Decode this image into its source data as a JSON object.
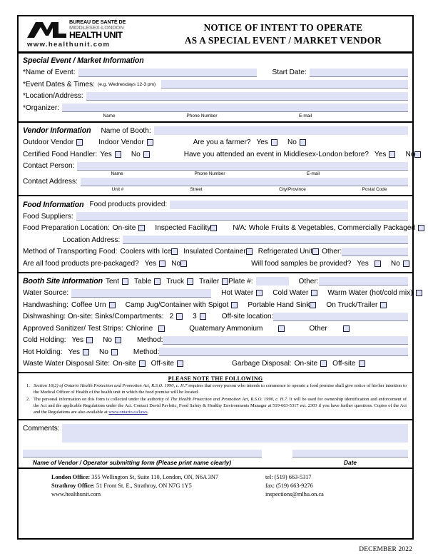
{
  "header": {
    "logo": {
      "line1": "BUREAU DE SANTÉ DE",
      "line2": "MIDDLESEX-LONDON",
      "line3": "HEALTH UNIT",
      "url": "www.healthunit.com"
    },
    "title_line1": "NOTICE OF INTENT TO OPERATE",
    "title_line2": "AS A SPECIAL EVENT / MARKET VENDOR"
  },
  "special_event": {
    "section_title": "Special Event / Market Information",
    "name_of_event_label": "*Name of Event:",
    "start_date_label": "Start Date:",
    "event_dates_label": "*Event Dates & Times",
    "event_dates_hint": "(e.g. Wednesdays 12-3 pm)",
    "location_label": "*Location/Address:",
    "organizer_label": "*Organizer:",
    "caption_name": "Name",
    "caption_phone": "Phone Number",
    "caption_email": "E-mail"
  },
  "vendor": {
    "section_title": "Vendor Information",
    "booth_label": "Name of Booth:",
    "outdoor_label": "Outdoor Vendor",
    "indoor_label": "Indoor Vendor",
    "farmer_label": "Are you a farmer?",
    "yes": "Yes",
    "no": "No",
    "certified_label": "Certified Food Handler:",
    "attended_label": "Have you attended an event in Middlesex-London before?",
    "contact_person_label": "Contact Person:",
    "contact_address_label": "Contact Address:",
    "caption_name": "Name",
    "caption_phone": "Phone Number",
    "caption_email": "E-mail",
    "caption_unit": "Unit #",
    "caption_street": "Street",
    "caption_city": "City/Province",
    "caption_postal": "Postal Code"
  },
  "food": {
    "section_title": "Food Information",
    "products_label": "Food products provided:",
    "suppliers_label": "Food Suppliers:",
    "prep_location_label": "Food Preparation Location:",
    "prep_onsite": "On-site",
    "prep_inspected": "Inspected Facility",
    "prep_na": "N/A: Whole Fruits & Vegetables, Commercially Packaged",
    "location_address_label": "Location Address:",
    "transport_label": "Method of Transporting Food:",
    "transport_coolers": "Coolers with Ice",
    "transport_insulated": "Insulated Container",
    "transport_refrigerated": "Refrigerated Unit",
    "transport_other": "Other:",
    "prepackaged_label": "Are all food products pre-packaged?",
    "samples_label": "Will food samples be provided?",
    "yes": "Yes",
    "no": "No"
  },
  "booth": {
    "section_title": "Booth Site Information",
    "tent": "Tent",
    "table": "Table",
    "truck": "Truck",
    "trailer": "Trailer",
    "plate_label": "Plate #:",
    "other_label": "Other:",
    "water_source_label": "Water Source:",
    "hot_water": "Hot Water",
    "cold_water": "Cold Water",
    "warm_water": "Warm Water (hot/cold mix)",
    "handwashing_label": "Handwashing:",
    "coffee_urn": "Coffee Urn",
    "camp_jug": "Camp Jug/Container with Spigot",
    "portable_sink": "Portable Hand Sink",
    "on_truck": "On Truck/Trailer",
    "dishwashing_label": "Dishwashing: On-site: Sinks/Compartments:",
    "sinks_2": "2",
    "sinks_3": "3",
    "offsite_location_label": "Off-site location:",
    "sanitizer_label": "Approved Sanitizer/ Test Strips:",
    "chlorine": "Chlorine",
    "quaternary": "Quatemary Ammonium",
    "other": "Other",
    "cold_holding_label": "Cold Holding:",
    "hot_holding_label": "Hot Holding:",
    "method_label": "Method:",
    "waste_label": "Waste Water Disposal Site:",
    "garbage_label": "Garbage Disposal:",
    "onsite": "On-site",
    "offsite": "Off-site",
    "yes": "Yes",
    "no": "No"
  },
  "notes": {
    "title": "PLEASE NOTE THE FOLLOWING",
    "items": [
      {
        "number": "1.",
        "italic_lead": "Section 16(2) of Ontario Health Protection and Promotion Act, R.S.O. 1990, c. H.7",
        "text": " requires that every person who intends to commence to operate a food premise shall give notice of his/her intention to the Medical Officer of Health of the health unit in which the food premise will be located."
      },
      {
        "number": "2.",
        "text_a": "The personal information on this form is collected under the authority of ",
        "italic_mid": "The Health Protection and Promotion Act, R.S.O. 1990, c. H.7",
        "text_b": ".  It will be used for ownership identification and enforcement of the Act and the applicable Regulations under the Act.  Contact David Pavletic, Food Safety & Healthy Environments Manager at 519-663-5317 ext. 2303 if you have further questions. Copies of the Act and the Regulations are also available at ",
        "link": "www.ontario.ca/laws",
        "text_c": "."
      }
    ]
  },
  "comments": {
    "label": "Comments:",
    "name_caption": "Name of Vendor / Operator submitting form (Please print name clearly)",
    "date_caption": "Date"
  },
  "footer": {
    "london_label": "London Office:",
    "london_address": " 355 Wellington St, Suite 110, London, ON, N6A 3N7",
    "strathroy_label": "Strathroy Office:",
    "strathroy_address": " 51 Front St. E., Strathroy, ON N7G 1Y5",
    "website": "www.healthunit.com",
    "tel": "tel: (519) 663-5317",
    "fax": "fax: (519) 663-9276",
    "email": "inspections@mlhu.on.ca"
  },
  "datestamp": "DECEMBER 2022"
}
